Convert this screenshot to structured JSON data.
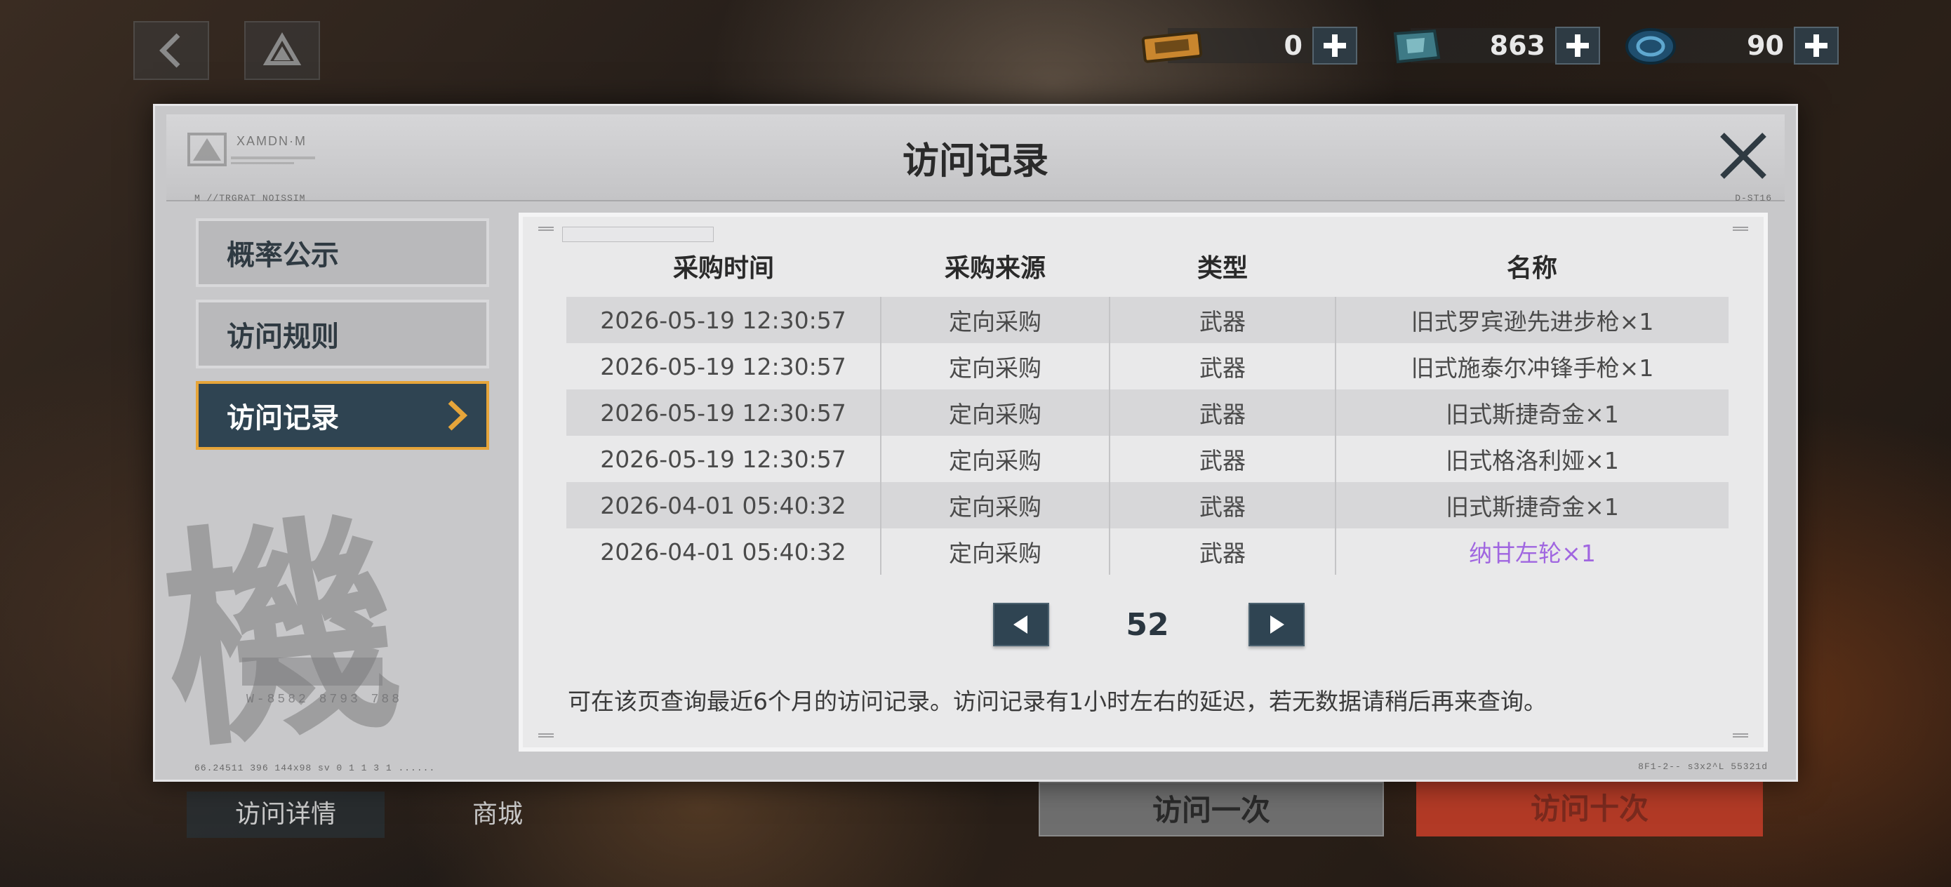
{
  "hud": {
    "resources": [
      {
        "name": "ticket-icon",
        "value": "0"
      },
      {
        "name": "crystal-icon",
        "value": "863"
      },
      {
        "name": "coin-icon",
        "value": "90"
      }
    ]
  },
  "dialog": {
    "title": "访问记录",
    "logo_text": "XAMDN·M",
    "micro_left": "M //TRGRAT NOISSIM",
    "micro_right": "D-ST16",
    "micro_bottom_left": "66.24511      396  144x98  sv  0 1 1 3   1 ......",
    "micro_bottom_right": "8F1-2--  s3x2^L  55321d"
  },
  "sidebar": {
    "items": [
      {
        "label": "概率公示",
        "active": false
      },
      {
        "label": "访问规则",
        "active": false
      },
      {
        "label": "访问记录",
        "active": true
      }
    ],
    "art_code": "W-8582  8793 788"
  },
  "table": {
    "headers": [
      "采购时间",
      "采购来源",
      "类型",
      "名称"
    ],
    "rows": [
      {
        "time": "2026-05-19 12:30:57",
        "source": "定向采购",
        "type": "武器",
        "name": "旧式罗宾逊先进步枪×1",
        "rarity": "normal"
      },
      {
        "time": "2026-05-19 12:30:57",
        "source": "定向采购",
        "type": "武器",
        "name": "旧式施泰尔冲锋手枪×1",
        "rarity": "normal"
      },
      {
        "time": "2026-05-19 12:30:57",
        "source": "定向采购",
        "type": "武器",
        "name": "旧式斯捷奇金×1",
        "rarity": "normal"
      },
      {
        "time": "2026-05-19 12:30:57",
        "source": "定向采购",
        "type": "武器",
        "name": "旧式格洛利娅×1",
        "rarity": "normal"
      },
      {
        "time": "2026-04-01 05:40:32",
        "source": "定向采购",
        "type": "武器",
        "name": "旧式斯捷奇金×1",
        "rarity": "normal"
      },
      {
        "time": "2026-04-01 05:40:32",
        "source": "定向采购",
        "type": "武器",
        "name": "纳甘左轮×1",
        "rarity": "purple"
      }
    ]
  },
  "pager": {
    "page": "52"
  },
  "footnote": "可在该页查询最近6个月的访问记录。访问记录有1小时左右的延迟，若无数据请稍后再来查询。",
  "bottom": {
    "tab_details": "访问详情",
    "tab_shop": "商城",
    "visit_once": "访问一次",
    "visit_ten": "访问十次"
  },
  "colors": {
    "accent_gold": "#e6a53a",
    "panel_dark": "#2f4452",
    "purple_rarity": "#a066e0",
    "visit_ten_red": "#b23a26"
  }
}
